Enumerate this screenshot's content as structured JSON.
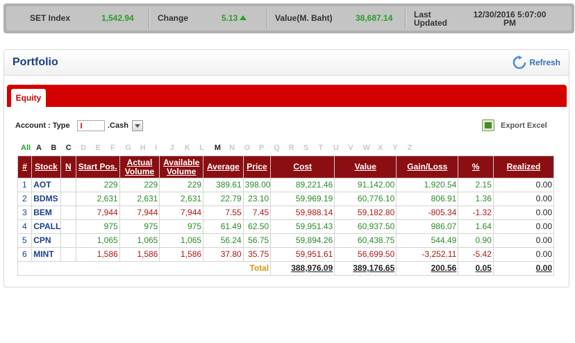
{
  "ticker": {
    "clipped_top_text": "...",
    "set_index_label": "SET Index",
    "set_index_value": "1,542.94",
    "change_label": "Change",
    "change_value": "5.13",
    "value_label": "Value(M. Baht)",
    "value_value": "38,687.14",
    "last_updated_label_1": "Last",
    "last_updated_label_2": "Updated",
    "last_updated_value_1": "12/30/2016 5:07:00",
    "last_updated_value_2": "PM"
  },
  "panel": {
    "title": "Portfolio",
    "refresh_label": "Refresh"
  },
  "tabs": {
    "equity_label": "Equity"
  },
  "account": {
    "label": "Account : Type",
    "input_value": "",
    "cash_label": ".Cash"
  },
  "export_label": "Export Excel",
  "alphabet": {
    "all": "All",
    "letters": [
      "A",
      "B",
      "C",
      "D",
      "E",
      "F",
      "G",
      "H",
      "I",
      "J",
      "K",
      "L",
      "M",
      "N",
      "O",
      "P",
      "Q",
      "R",
      "S",
      "T",
      "U",
      "V",
      "W",
      "X",
      "Y",
      "Z"
    ],
    "active": [
      "A",
      "B",
      "C",
      "M"
    ]
  },
  "table": {
    "headers": {
      "num": "#",
      "stock": "Stock",
      "n": "N",
      "start_pos": "Start Pos.",
      "actual_volume_1": "Actual",
      "actual_volume_2": "Volume",
      "available_volume_1": "Available",
      "available_volume_2": "Volume",
      "average": "Average",
      "price": "Price",
      "cost": "Cost",
      "value": "Value",
      "gain_loss": "Gain/Loss",
      "pct": "%",
      "realized": "Realized"
    },
    "rows": [
      {
        "num": "1",
        "stock": "AOT",
        "n": "",
        "start": "229",
        "actual": "229",
        "available": "229",
        "average": "389.61",
        "price": "398.00",
        "cost": "89,221.46",
        "value": "91,142.00",
        "gain": "1,920.54",
        "pct": "2.15",
        "realized": "0.00",
        "sign": "pos"
      },
      {
        "num": "2",
        "stock": "BDMS",
        "n": "",
        "start": "2,631",
        "actual": "2,631",
        "available": "2,631",
        "average": "22.79",
        "price": "23.10",
        "cost": "59,969.19",
        "value": "60,776.10",
        "gain": "806.91",
        "pct": "1.36",
        "realized": "0.00",
        "sign": "pos"
      },
      {
        "num": "3",
        "stock": "BEM",
        "n": "",
        "start": "7,944",
        "actual": "7,944",
        "available": "7,944",
        "average": "7.55",
        "price": "7.45",
        "cost": "59,988.14",
        "value": "59,182.80",
        "gain": "-805.34",
        "pct": "-1.32",
        "realized": "0.00",
        "sign": "neg"
      },
      {
        "num": "4",
        "stock": "CPALL",
        "n": "",
        "start": "975",
        "actual": "975",
        "available": "975",
        "average": "61.49",
        "price": "62.50",
        "cost": "59,951.43",
        "value": "60,937.50",
        "gain": "986.07",
        "pct": "1.64",
        "realized": "0.00",
        "sign": "pos"
      },
      {
        "num": "5",
        "stock": "CPN",
        "n": "",
        "start": "1,065",
        "actual": "1,065",
        "available": "1,065",
        "average": "56.24",
        "price": "56.75",
        "cost": "59,894.26",
        "value": "60,438.75",
        "gain": "544.49",
        "pct": "0.90",
        "realized": "0.00",
        "sign": "pos"
      },
      {
        "num": "6",
        "stock": "MINT",
        "n": "",
        "start": "1,586",
        "actual": "1,586",
        "available": "1,586",
        "average": "37.80",
        "price": "35.75",
        "cost": "59,951.61",
        "value": "56,699.50",
        "gain": "-3,252.11",
        "pct": "-5.42",
        "realized": "0.00",
        "sign": "neg"
      }
    ],
    "total": {
      "label": "Total",
      "cost": "388,976.09",
      "value": "389,176.65",
      "gain": "200.56",
      "pct": "0.05",
      "realized": "0.00"
    }
  },
  "colors": {
    "header_red": "#8b0f12",
    "band_red": "#d40000",
    "positive_green": "#2a8a2a",
    "negative_red": "#b01515",
    "title_blue": "#1a3e8c"
  }
}
